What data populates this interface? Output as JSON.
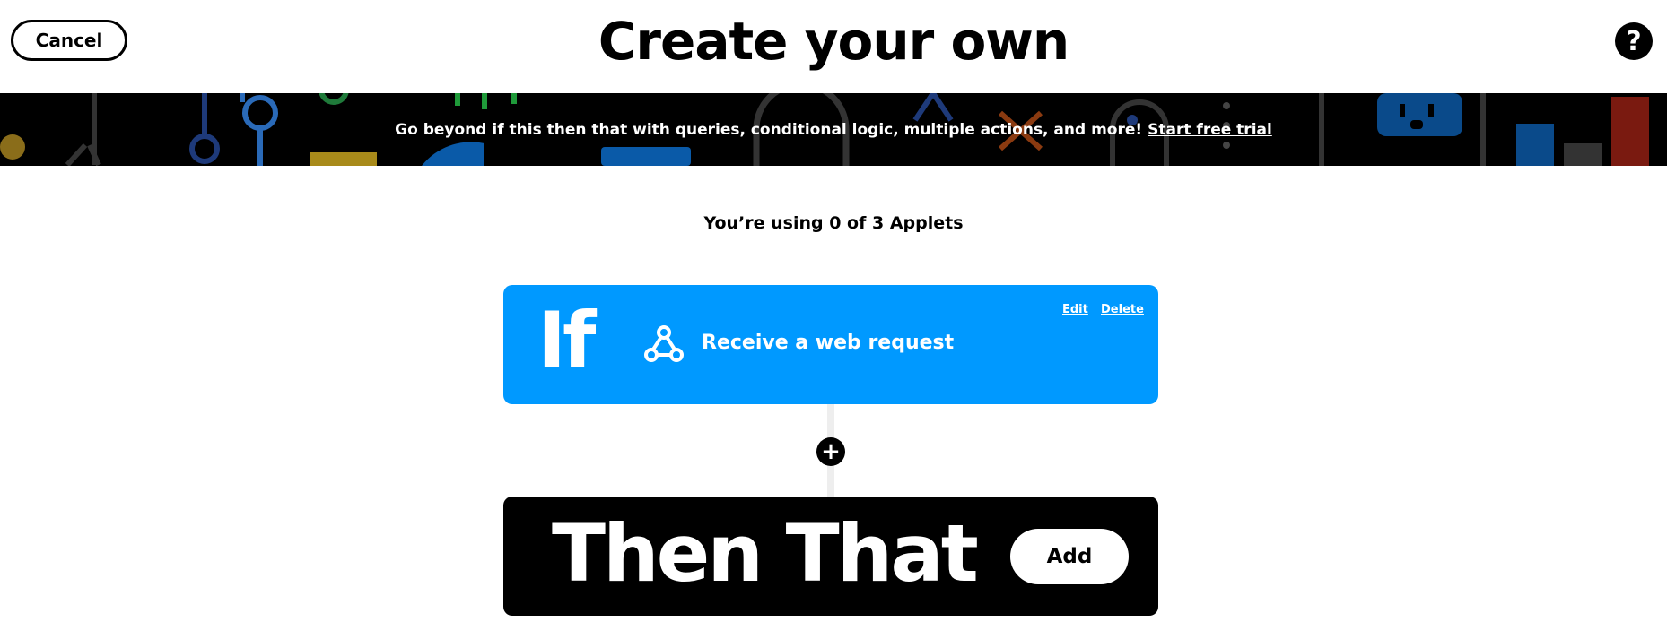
{
  "header": {
    "cancel_label": "Cancel",
    "title": "Create your own",
    "help_icon": "question-mark-icon",
    "help_glyph": "?"
  },
  "banner": {
    "text": "Go beyond if this then that with queries, conditional logic, multiple actions, and more!",
    "link_label": "Start free trial"
  },
  "usage": {
    "text": "You’re using 0 of 3 Applets"
  },
  "if_card": {
    "keyword": "If",
    "service_icon": "webhook-icon",
    "trigger_label": "Receive a web request",
    "edit_label": "Edit",
    "delete_label": "Delete",
    "color": "#0099ff"
  },
  "add_step": {
    "icon": "plus-icon",
    "glyph": "+"
  },
  "then_card": {
    "keyword": "Then That",
    "add_label": "Add",
    "color": "#000000"
  }
}
